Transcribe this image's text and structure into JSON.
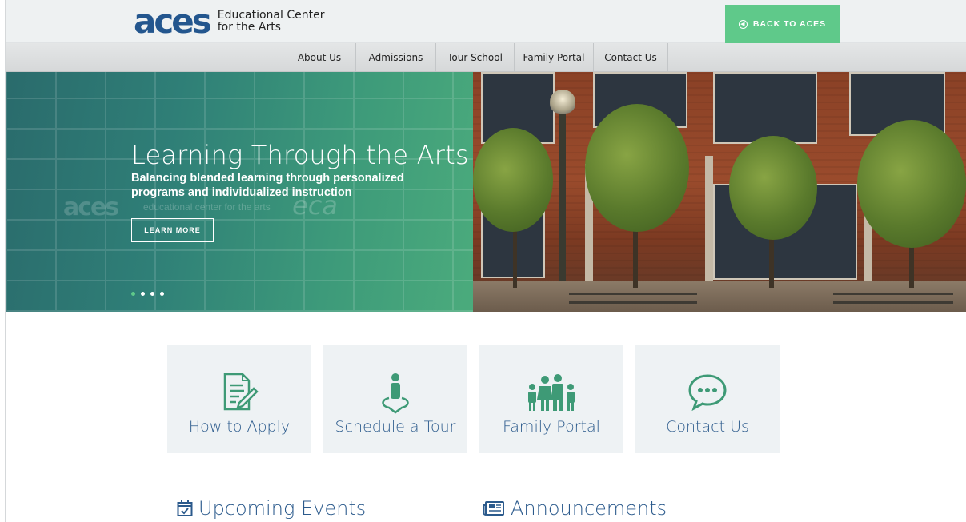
{
  "header": {
    "logo_mark": "aces",
    "logo_text_line1": "Educational Center",
    "logo_text_line2": "for the Arts",
    "back_button": "BACK TO ACES"
  },
  "nav": {
    "items": [
      {
        "label": "About Us"
      },
      {
        "label": "Admissions"
      },
      {
        "label": "Tour School"
      },
      {
        "label": "Family Portal"
      },
      {
        "label": "Contact Us"
      }
    ]
  },
  "hero": {
    "title": "Learning Through the Arts",
    "subtitle": "Balancing blended learning through personalized programs and individualized instruction",
    "cta": "LEARN MORE",
    "watermark_mark": "aces",
    "watermark_text": "educational center for the arts",
    "watermark_eca": "eca",
    "slide_count": 4,
    "active_slide": 1
  },
  "quick_links": [
    {
      "label": "How to Apply",
      "icon": "document-pencil-icon"
    },
    {
      "label": "Schedule a Tour",
      "icon": "person-location-icon"
    },
    {
      "label": "Family Portal",
      "icon": "family-icon"
    },
    {
      "label": "Contact Us",
      "icon": "chat-bubble-icon"
    }
  ],
  "sections": {
    "events_title": "Upcoming Events",
    "announcements_title": "Announcements"
  },
  "colors": {
    "brand_blue": "#23568e",
    "accent_green": "#5fc98a",
    "icon_green": "#3e9a76",
    "link_blue": "#2b5a8c"
  }
}
